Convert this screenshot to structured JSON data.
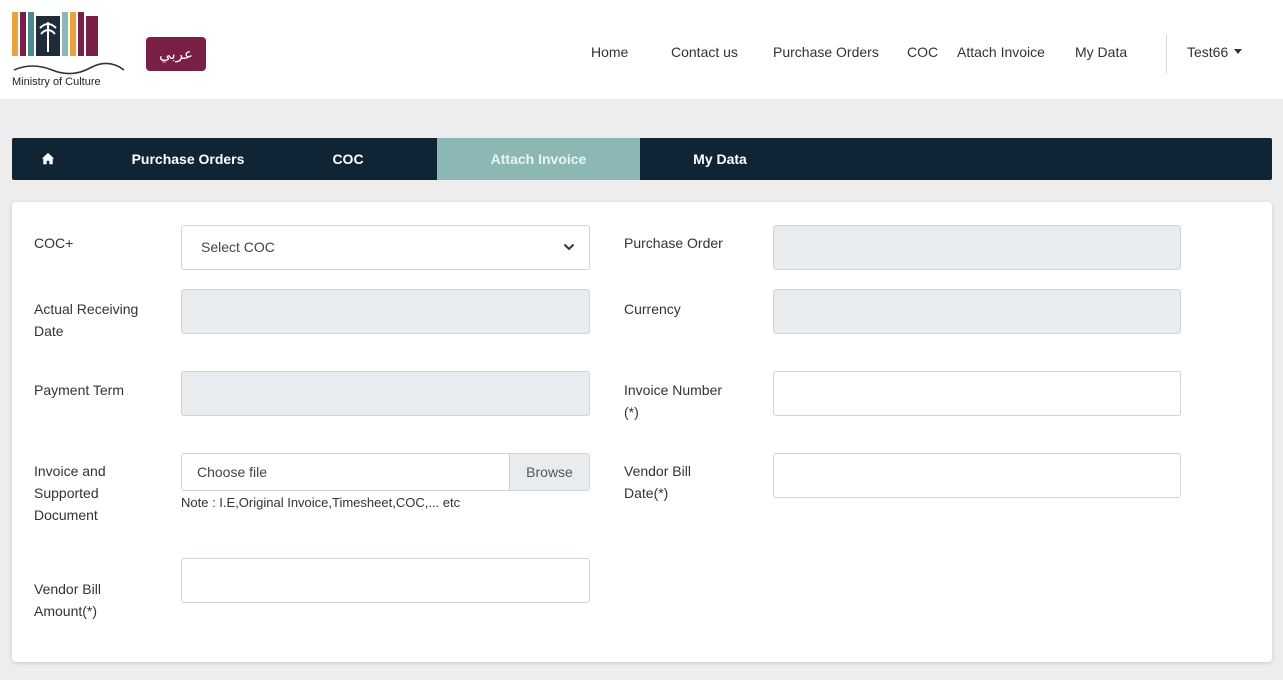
{
  "header": {
    "logo_text": "Ministry of Culture",
    "lang_button": "عربي",
    "nav": [
      "Home",
      "Contact us",
      "Purchase Orders",
      "COC",
      "Attach Invoice",
      "My Data"
    ],
    "user": "Test66"
  },
  "tabs": {
    "items": [
      "Purchase Orders",
      "COC",
      "Attach Invoice",
      "My Data"
    ],
    "active": "Attach Invoice"
  },
  "form": {
    "coc_label": "COC+",
    "coc_select": "Select COC",
    "purchase_order_label": "Purchase Order",
    "actual_receiving_label_1": "Actual Receiving",
    "actual_receiving_label_2": "Date",
    "currency_label": "Currency",
    "payment_term_label": "Payment Term",
    "invoice_number_label_1": "Invoice Number",
    "invoice_number_label_2": "(*)",
    "invoice_doc_label_1": "Invoice and",
    "invoice_doc_label_2": "Supported",
    "invoice_doc_label_3": "Document",
    "file_placeholder": "Choose file",
    "browse_label": "Browse",
    "file_note": "Note : I.E,Original Invoice,Timesheet,COC,... etc",
    "vendor_bill_date_label_1": "Vendor Bill",
    "vendor_bill_date_label_2": "Date(*)",
    "vendor_bill_amount_label_1": "Vendor Bill",
    "vendor_bill_amount_label_2": "Amount(*)"
  },
  "colors": {
    "brand": "#7a1f45",
    "tabbar": "#0f2435",
    "tab_active": "#8bb8b4"
  }
}
